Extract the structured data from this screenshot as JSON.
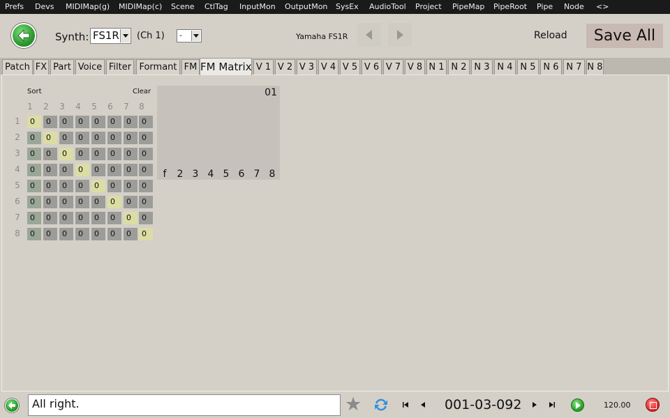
{
  "menu": [
    "Prefs",
    "Devs",
    "MIDIMap(g)",
    "MIDIMap(c)",
    "Scene",
    "CtlTag",
    "InputMon",
    "OutputMon",
    "SysEx",
    "AudioTool",
    "Project",
    "PipeMap",
    "PipeRoot",
    "Pipe",
    "Node",
    "<>"
  ],
  "header": {
    "synth_label": "Synth:",
    "synth_value": "FS1R",
    "channel": "(Ch 1)",
    "small_select_value": "-",
    "device_name": "Yamaha FS1R",
    "reload": "Reload",
    "save_all": "Save All"
  },
  "tabs": [
    "Patch",
    "FX",
    "Part",
    "Voice",
    "Filter",
    "Formant",
    "FM",
    "FM Matrix",
    "V 1",
    "V 2",
    "V 3",
    "V 4",
    "V 5",
    "V 6",
    "V 7",
    "V 8",
    "N 1",
    "N 2",
    "N 3",
    "N 4",
    "N 5",
    "N 6",
    "N 7",
    "N 8"
  ],
  "active_tab": "FM Matrix",
  "matrix": {
    "sort_label": "Sort",
    "clear_label": "Clear",
    "col_labels": [
      "1",
      "2",
      "3",
      "4",
      "5",
      "6",
      "7",
      "8"
    ],
    "row_labels": [
      "1",
      "2",
      "3",
      "4",
      "5",
      "6",
      "7",
      "8"
    ],
    "values": [
      [
        "0",
        "0",
        "0",
        "0",
        "0",
        "0",
        "0",
        "0"
      ],
      [
        "0",
        "0",
        "0",
        "0",
        "0",
        "0",
        "0",
        "0"
      ],
      [
        "0",
        "0",
        "0",
        "0",
        "0",
        "0",
        "0",
        "0"
      ],
      [
        "0",
        "0",
        "0",
        "0",
        "0",
        "0",
        "0",
        "0"
      ],
      [
        "0",
        "0",
        "0",
        "0",
        "0",
        "0",
        "0",
        "0"
      ],
      [
        "0",
        "0",
        "0",
        "0",
        "0",
        "0",
        "0",
        "0"
      ],
      [
        "0",
        "0",
        "0",
        "0",
        "0",
        "0",
        "0",
        "0"
      ],
      [
        "0",
        "0",
        "0",
        "0",
        "0",
        "0",
        "0",
        "0"
      ]
    ]
  },
  "algorithm": {
    "number": "01",
    "operators": [
      "f",
      "2",
      "3",
      "4",
      "5",
      "6",
      "7",
      "8"
    ]
  },
  "status": {
    "message": "All right.",
    "position": "001-03-092",
    "tempo": "120.00"
  },
  "colors": {
    "cell_default": "#9c9d98",
    "cell_first_column": "#9aa698",
    "cell_diagonal": "#dcdca5",
    "save_button": "#c9b9b3"
  },
  "icons": [
    "back-arrow-icon",
    "star-icon",
    "sync-icon",
    "skip-start-icon",
    "step-back-icon",
    "step-forward-icon",
    "skip-end-icon",
    "play-icon",
    "stop-icon"
  ]
}
